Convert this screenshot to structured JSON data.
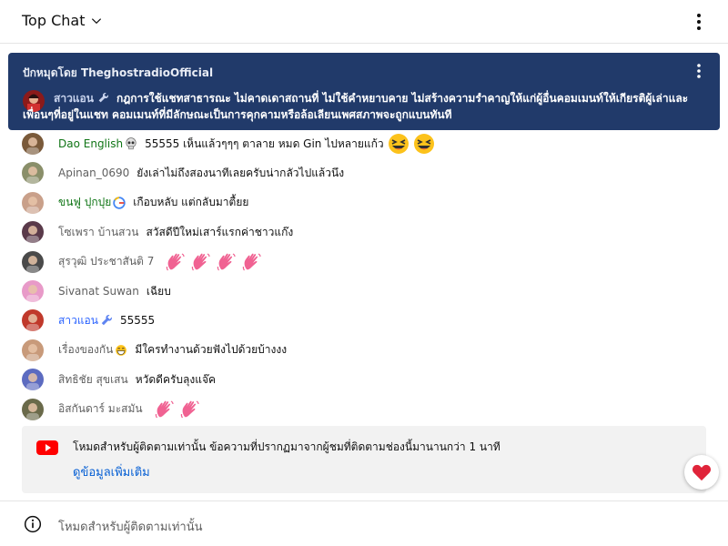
{
  "header": {
    "title": "Top Chat"
  },
  "pinned": {
    "pinned_by": "ปักหมุดโดย TheghostradioOfficial",
    "author": "สาวแอน",
    "text": "กฎการใช้แชทสาธารณะ ไม่คาดเดาสถานที่ ไม่ใช้คำหยาบคาย ไม่สร้างความรำคาญให้แก่ผู้อื่นคอมเมนท์ให้เกียรติผู้เล่าและเพื่อนๆที่อยู่ในแชท คอมเมนท์ที่มีลักษณะเป็นการคุกคามหรือล้อเลียนเพศสภาพจะถูกแบนทันที"
  },
  "messages": [
    {
      "author": "Dao English",
      "author_style": "green",
      "text": "55555 เห็นแล้วๆๆๆ ตาลาย หมด Gin ไปหลายแก้ว",
      "emojis": [
        "laughing",
        "laughing"
      ],
      "avatar_color": "#7a5a3a",
      "badge": "skull"
    },
    {
      "author": "Apinan_0690",
      "author_style": "gray",
      "text": "ยังเล่าไม่ถึงสองนาทีเลยครับน่ากลัวไปแล้วนึง",
      "emojis": [],
      "avatar_color": "#8a8f6a"
    },
    {
      "author": "ขนฟู ปุกปุย",
      "author_style": "green",
      "text": "เกือบหลับ แต่กลับมาตื้ยย",
      "emojis": [],
      "avatar_color": "#c9a08a",
      "badge": "g"
    },
    {
      "author": "โซเพรา บ้านสวน",
      "author_style": "gray",
      "text": "สวัสดีปีใหม่เสาร์แรกค่าชาวแก๊ง",
      "emojis": [],
      "avatar_color": "#5a3a4a"
    },
    {
      "author": "สุรวุฒิ ประชาสันติ 7",
      "author_style": "gray",
      "text": "",
      "emojis": [
        "wave",
        "wave",
        "wave",
        "wave"
      ],
      "avatar_color": "#4a4a4a"
    },
    {
      "author": "Sivanat Suwan",
      "author_style": "gray",
      "text": "เฉียบ",
      "emojis": [],
      "avatar_color": "#e89ac8"
    },
    {
      "author": "สาวแอน",
      "author_style": "blue",
      "text": "55555",
      "emojis": [],
      "avatar_color": "#c0392b",
      "badge": "wrench"
    },
    {
      "author": "เรื่องของกัน",
      "author_style": "gray",
      "text": "มีใครทำงานด้วยฟังไปด้วยบ้างงง",
      "emojis": [],
      "avatar_color": "#c89a7a",
      "badge": "grin"
    },
    {
      "author": "สิทธิชัย สุขเสน",
      "author_style": "gray",
      "text": "หวัดดีครับลุงแจ๊ค",
      "emojis": [],
      "avatar_color": "#5c6bc0"
    },
    {
      "author": "อิสกันดาร์ มะสมัน",
      "author_style": "gray",
      "text": "",
      "emojis": [
        "wave",
        "wave"
      ],
      "avatar_color": "#6a6a4a"
    }
  ],
  "notice": {
    "text": "โหมดสำหรับผู้ติดตามเท่านั้น ข้อความที่ปรากฏมาจากผู้ชมที่ติดตามช่องนี้มานานกว่า 1 นาที",
    "link": "ดูข้อมูลเพิ่มเติม"
  },
  "footer": {
    "text": "โหมดสำหรับผู้ติดตามเท่านั้น"
  },
  "colors": {
    "pinned_bg": "#213a6a",
    "link": "#065fd4",
    "heart": "#e0243a"
  }
}
